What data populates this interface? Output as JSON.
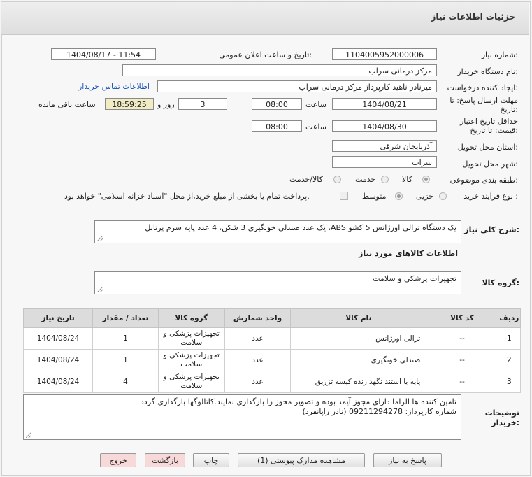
{
  "header": {
    "title": "جزئیات اطلاعات نیاز"
  },
  "form": {
    "need_number_label": "شماره نیاز:",
    "need_number": "1104005952000006",
    "announce_label": "تاریخ و ساعت اعلان عمومی:",
    "announce_value": "1404/08/17 - 11:54",
    "buyer_org_label": "نام دستگاه خریدار:",
    "buyer_org": "مرکز درمانی سراب",
    "creator_label": "ایجاد کننده درخواست:",
    "creator": "میرنادر ناهید کارپرداز مرکز درمانی سراب",
    "contact_link": "اطلاعات تماس خریدار",
    "reply_deadline_label_1": "مهلت ارسال پاسخ: تا",
    "reply_deadline_label_2": "تاریخ:",
    "reply_date": "1404/08/21",
    "time_label": "ساعت",
    "reply_time": "08:00",
    "days_value": "3",
    "days_label": "روز و",
    "remaining_time": "18:59:25",
    "remaining_label": "ساعت باقی مانده",
    "validity_label_1": "حداقل تاریخ اعتبار",
    "validity_label_2": "قیمت: تا تاریخ:",
    "validity_date": "1404/08/30",
    "validity_time": "08:00",
    "province_label": "استان محل تحویل:",
    "province": "آذربایجان شرقی",
    "city_label": "شهر محل تحویل:",
    "city": "سراب",
    "category_label": "طبقه بندی موضوعی:",
    "category_options": [
      "کالا",
      "خدمت",
      "کالا/خدمت"
    ],
    "category_selected": "کالا",
    "process_label": "نوع فرآیند خرید :",
    "process_options": [
      "جزیی",
      "متوسط"
    ],
    "process_selected": "جزیی",
    "payment_note": "پرداخت تمام یا بخشی از مبلغ خرید،از محل \"اسناد خزانه اسلامی\" خواهد بود."
  },
  "description": {
    "label": "شرح کلی نیاز:",
    "text": "یک دستگاه ترالی اورژانس 5 کشو ABS، یک عدد صندلی خونگیری 3 شکن، 4 عدد پایه سرم پرتابل"
  },
  "goods": {
    "section_title": "اطلاعات کالاهای مورد نیاز",
    "group_label": "گروه کالا:",
    "group_value": "تجهیزات پزشکی و سلامت",
    "columns": [
      "ردیف",
      "کد کالا",
      "نام کالا",
      "واحد شمارش",
      "گروه کالا",
      "تعداد / مقدار",
      "تاریخ نیاز"
    ],
    "rows": [
      {
        "idx": "1",
        "code": "--",
        "name": "ترالی اورژانس",
        "unit": "عدد",
        "group": "تجهیزات پزشکی و سلامت",
        "qty": "1",
        "date": "1404/08/24"
      },
      {
        "idx": "2",
        "code": "--",
        "name": "صندلی خونگیری",
        "unit": "عدد",
        "group": "تجهیزات پزشکی و سلامت",
        "qty": "1",
        "date": "1404/08/24"
      },
      {
        "idx": "3",
        "code": "--",
        "name": "پایه یا استند نگهدارنده کیسه تزریق",
        "unit": "عدد",
        "group": "تجهیزات پزشکی و سلامت",
        "qty": "4",
        "date": "1404/08/24"
      }
    ]
  },
  "buyer_notes": {
    "label_1": "توضیحات",
    "label_2": "خریدار:",
    "line1": "تامین کننده ها الزاما دارای مجوز آیمد بوده و تصویر مجوز را بارگذاری نمایند.کاتالوگها بارگذاری گردد",
    "line2": "شماره کارپرداز: 09211294278 (نادر راپانفرد)"
  },
  "buttons": {
    "reply": "پاسخ به نیاز",
    "attachments": "مشاهده مدارک پیوستی (1)",
    "print": "چاپ",
    "back": "بازگشت",
    "exit": "خروج"
  },
  "colors": {
    "timer_bg": "#f1ecc3",
    "link": "#1a57b8",
    "watermark": "#e07070"
  }
}
